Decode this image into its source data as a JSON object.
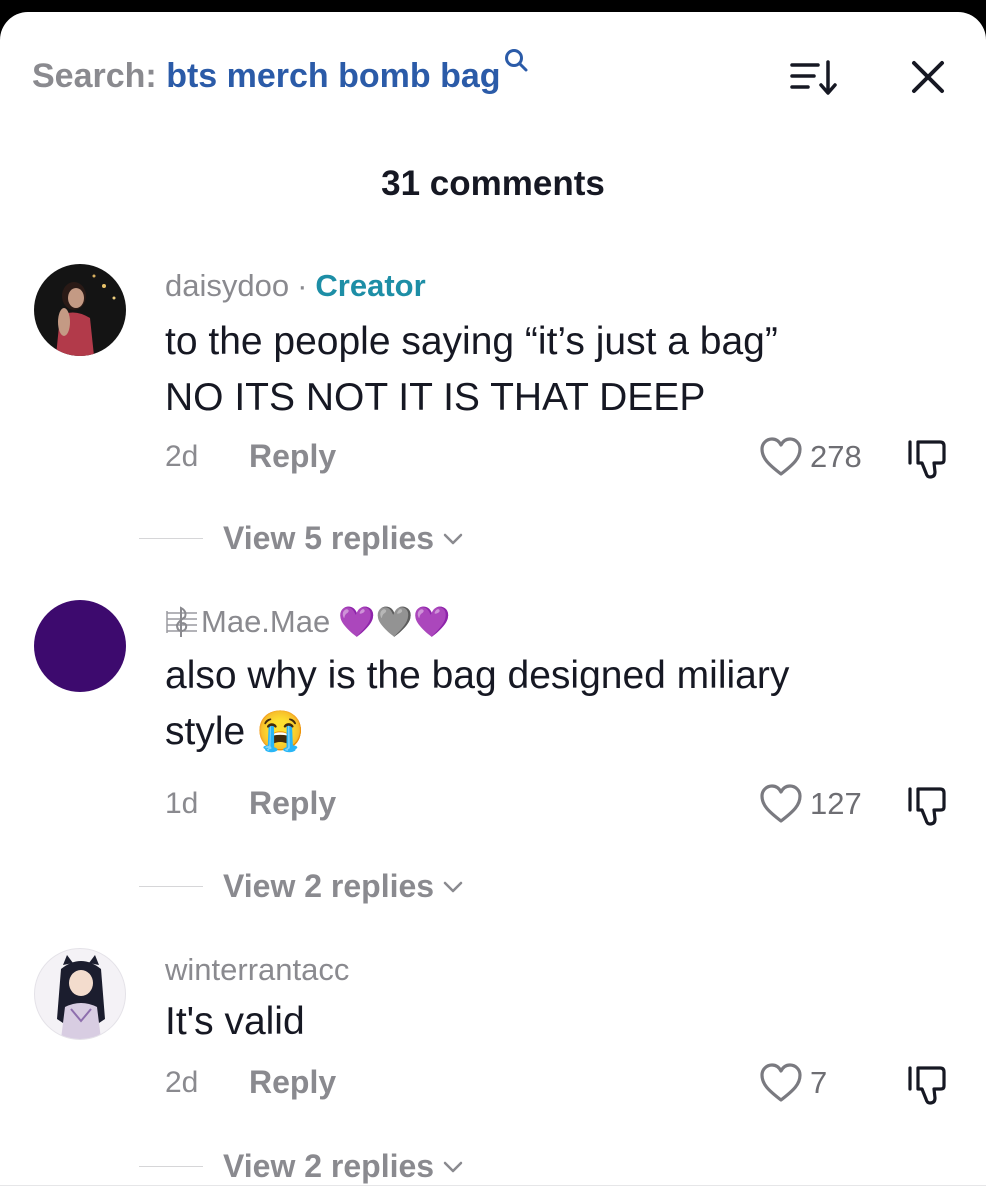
{
  "header": {
    "search_prefix": "Search:",
    "search_query": "bts merch bomb bag",
    "search_icon": "magnifier-icon",
    "sort_icon": "sort-icon",
    "close_icon": "close-icon",
    "comment_count": "31 comments"
  },
  "comments": [
    {
      "username": "daisydoo",
      "separator": "·",
      "badge": "Creator",
      "text_line1": "to the people saying “it’s just a bag”",
      "text_line2": "NO ITS NOT IT IS THAT DEEP",
      "time": "2d",
      "reply_label": "Reply",
      "likes": "278",
      "view_replies": "View 5 replies"
    },
    {
      "username": "Mae.Mae",
      "username_prefix_icon": "music-score-icon",
      "username_suffix": "💜🩶💜",
      "text_line1": "also why is the bag designed miliary",
      "text_line2": "style 😭",
      "time": "1d",
      "reply_label": "Reply",
      "likes": "127",
      "view_replies": "View 2 replies"
    },
    {
      "username": "winterrantacc",
      "text_line1": "It's valid",
      "time": "2d",
      "reply_label": "Reply",
      "likes": "7",
      "view_replies": "View 2 replies"
    }
  ],
  "colors": {
    "query_blue": "#2b5ba8",
    "creator_teal": "#1d8ea6",
    "muted_gray": "#8a8a8f",
    "avatar_purple": "#3d0a6e"
  }
}
